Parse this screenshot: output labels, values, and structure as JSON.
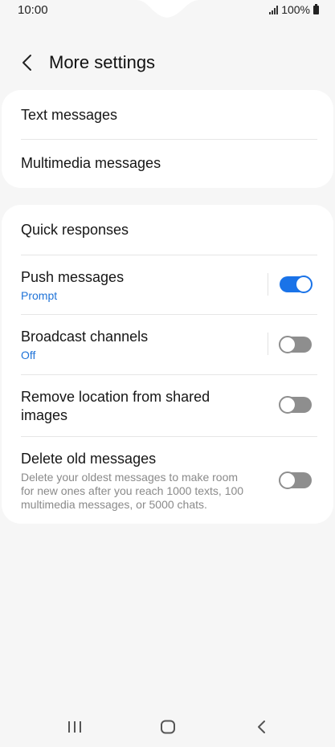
{
  "status_bar": {
    "time": "10:00",
    "battery": "100%"
  },
  "header": {
    "title": "More settings"
  },
  "group1": {
    "items": [
      {
        "label": "Text messages"
      },
      {
        "label": "Multimedia messages"
      }
    ]
  },
  "group2": {
    "quick_responses": {
      "label": "Quick responses"
    },
    "push_messages": {
      "label": "Push messages",
      "sub": "Prompt",
      "enabled": true
    },
    "broadcast_channels": {
      "label": "Broadcast channels",
      "sub": "Off",
      "enabled": false
    },
    "remove_location": {
      "label_line1": "Remove location from shared",
      "label_line2": "images",
      "enabled": false
    },
    "delete_old": {
      "label": "Delete old messages",
      "desc_line1": "Delete your oldest messages to make room",
      "desc_line2": "for new ones after you reach 1000 texts, 100",
      "desc_line3": "multimedia messages, or 5000 chats.",
      "enabled": false
    }
  },
  "colors": {
    "accent": "#1a73e8",
    "sublabel": "#1f73d8",
    "background": "#f6f6f6",
    "card": "#ffffff",
    "switch_off": "#8e8e8e"
  },
  "icons": {
    "back": "chevron-left-icon",
    "signal": "signal-icon",
    "battery": "battery-icon",
    "nav_recents": "recents-icon",
    "nav_home": "home-icon",
    "nav_back": "back-arrow-icon"
  }
}
